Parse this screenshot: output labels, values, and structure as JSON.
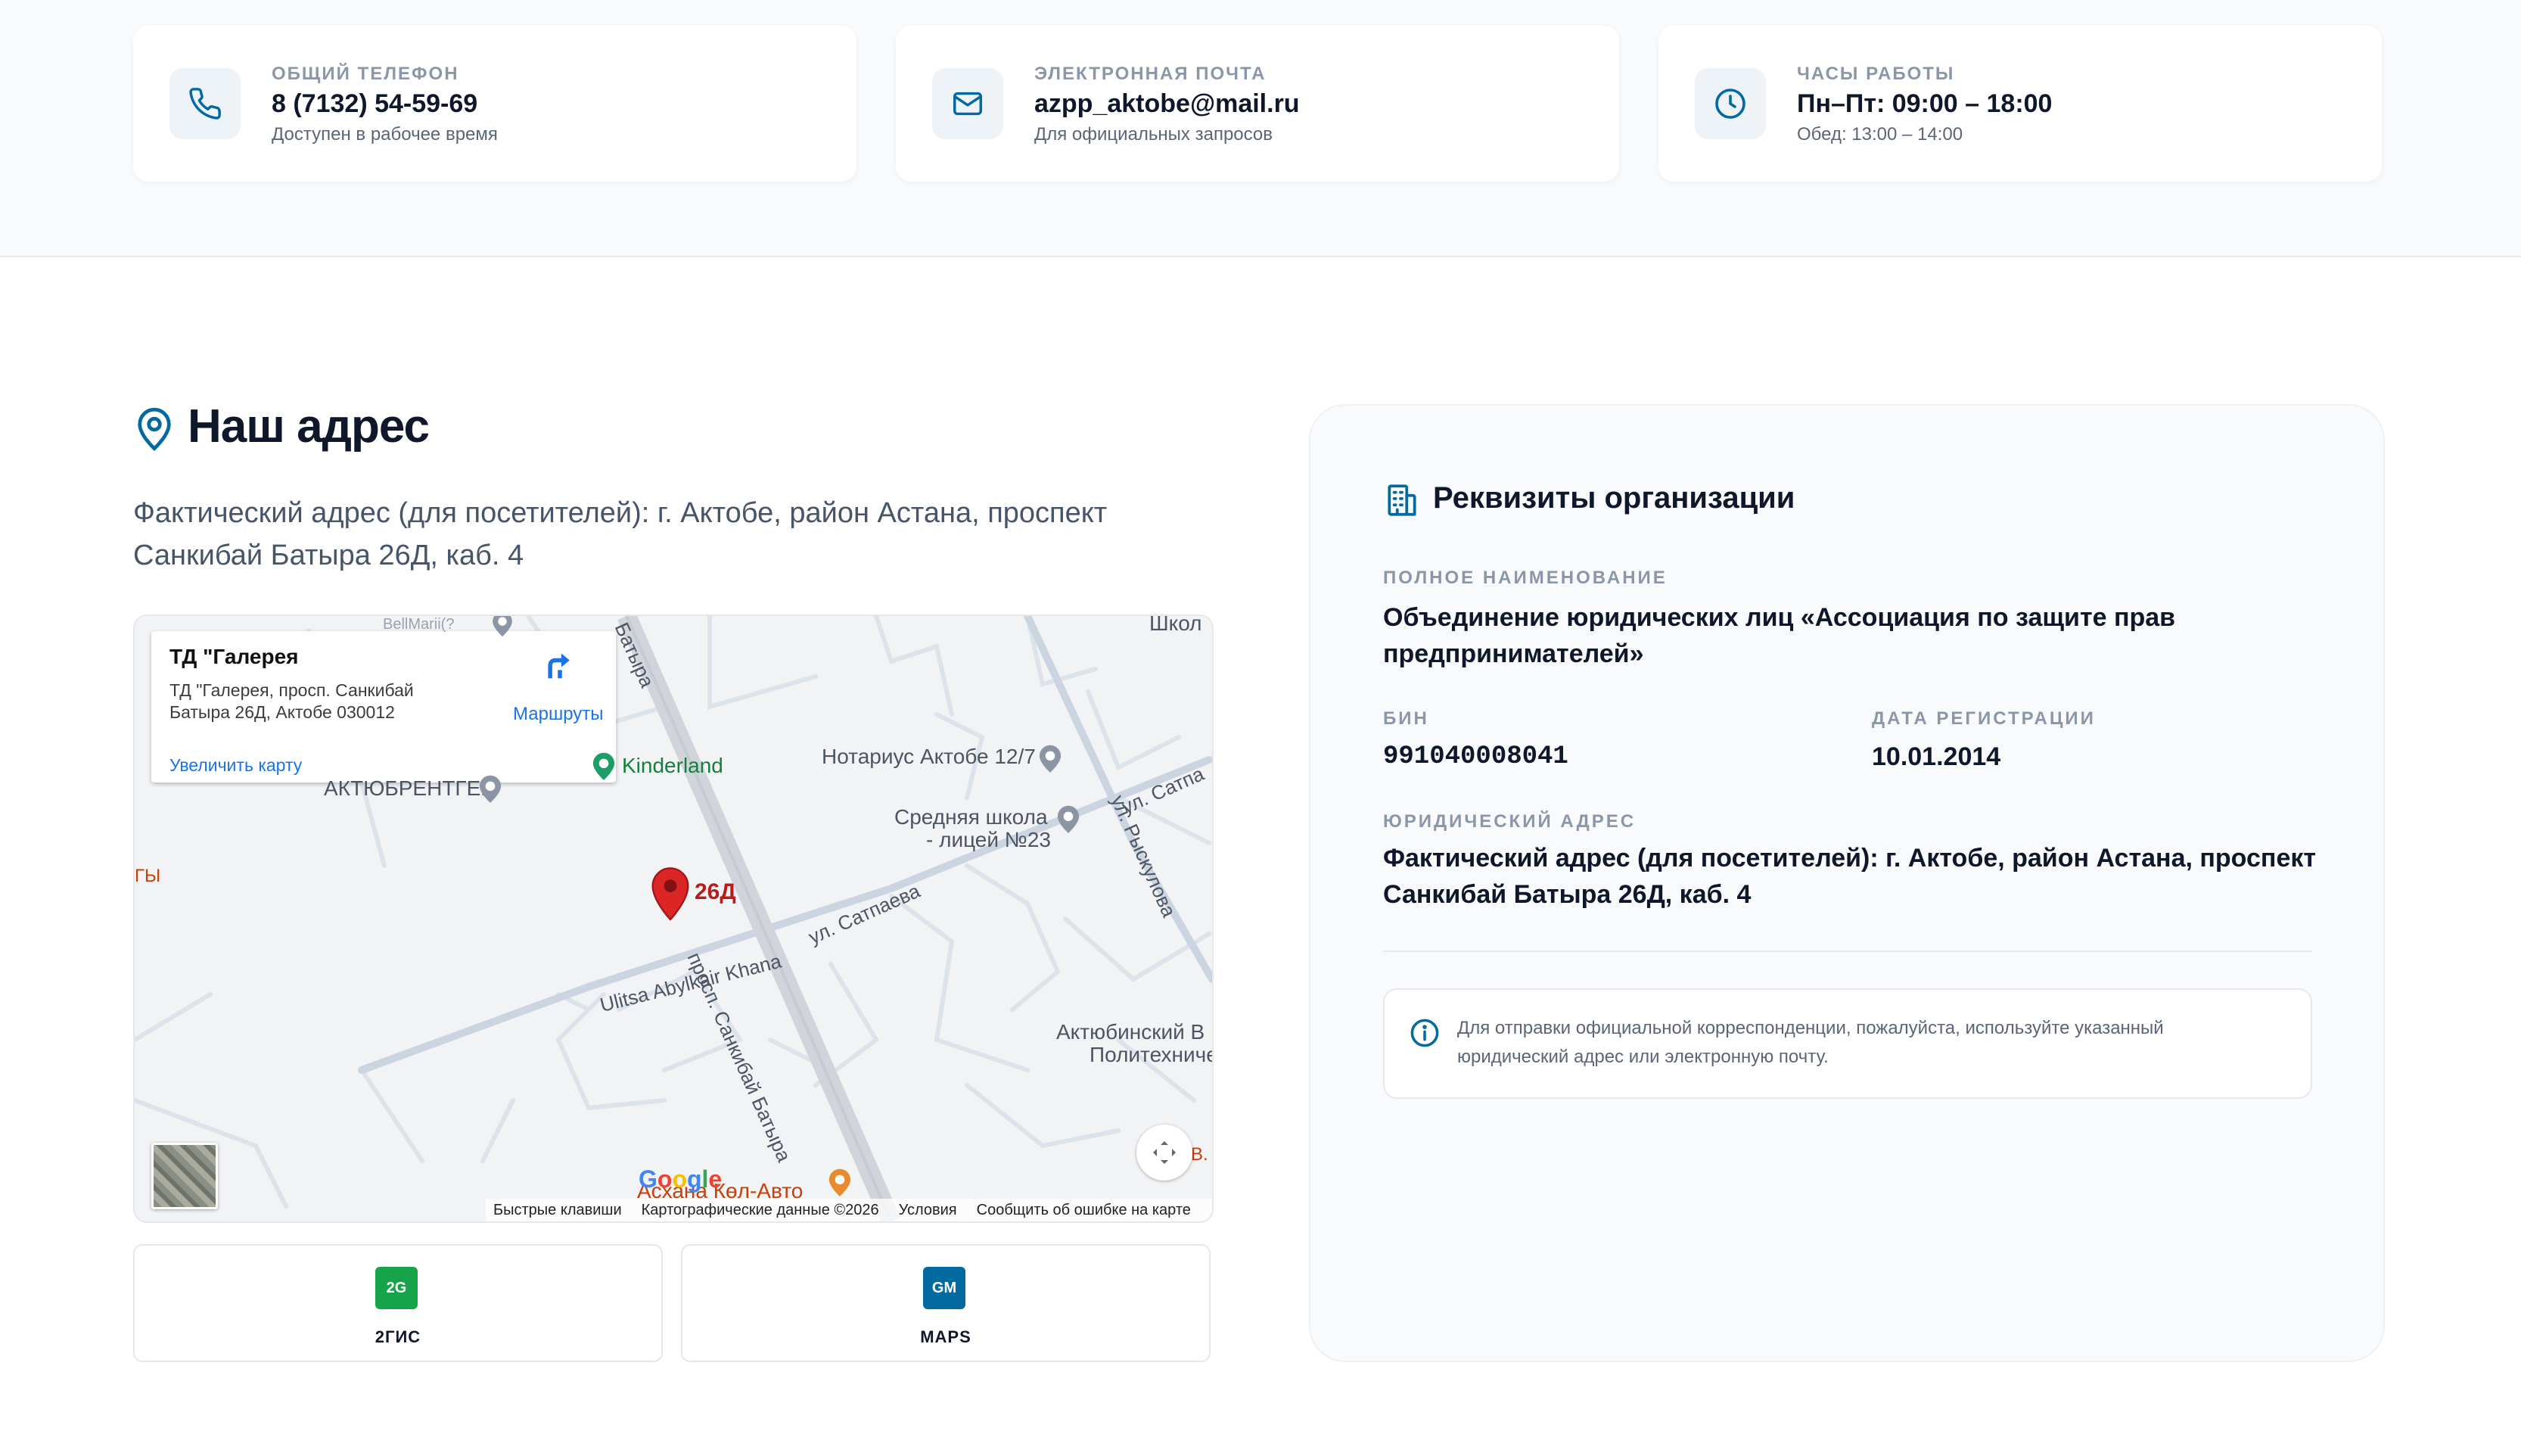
{
  "colors": {
    "accent": "#0369a1",
    "green_2gis": "#16a34a",
    "blue_gmaps": "#0369a1",
    "pin_red": "#dc2626"
  },
  "contacts": [
    {
      "icon": "phone-icon",
      "eyebrow": "ОБЩИЙ ТЕЛЕФОН",
      "value": "8 (7132) 54-59-69",
      "sub": "Доступен в рабочее время"
    },
    {
      "icon": "mail-icon",
      "eyebrow": "ЭЛЕКТРОННАЯ ПОЧТА",
      "value": "azpp_aktobe@mail.ru",
      "sub": "Для официальных запросов"
    },
    {
      "icon": "clock-icon",
      "eyebrow": "ЧАСЫ РАБОТЫ",
      "value": "Пн–Пт: 09:00 – 18:00",
      "sub": "Обед: 13:00 – 14:00"
    }
  ],
  "address": {
    "title": "Наш адрес",
    "text": "Фактический адрес (для посетителей): г. Актобе, район Астана, проспект Санкибай Батыра 26Д, каб. 4"
  },
  "map": {
    "place_title": "ТД \"Галерея",
    "place_address": "ТД \"Галерея, просп. Санкибай Батыра 26Д, Актобе 030012",
    "enlarge": "Увеличить карту",
    "routes": "Маршруты",
    "pin_label": "26Д",
    "google": "Google",
    "footer": {
      "shortcuts": "Быстрые клавиши",
      "map_data": "Картографические данные ©2026",
      "terms": "Условия",
      "report": "Сообщить об ошибке на карте"
    },
    "labels": {
      "kinderland": "Kinderland",
      "aktyubrentgen": "АКТЮБРЕНТГЕН",
      "notary": "Нотариус Актобе 12/7",
      "school_line1": "Средняя школа",
      "school_line2": "- лицей №23",
      "avenue": "просп. Санкибай Батыра",
      "avenue_top": "Батыра",
      "satpaeva": "ул. Сатпаева",
      "satpaeva_right": "ул. Сатпа",
      "ryskulova": "ул. Рыскулова",
      "abylkair": "Ulitsa Abylkair Khana",
      "aktobe_poly1": "Актюбинский В",
      "aktobe_poly2": "Политехничес",
      "askhana": "Асхана Көл-Авто",
      "shkol": "Школ",
      "left_partial": "ГЫ",
      "right_partial": "В.",
      "top_partial": "BellMarii(?"
    }
  },
  "map_buttons": [
    {
      "badge": "2G",
      "label": "2ГИС"
    },
    {
      "badge": "GM",
      "label": "MAPS"
    }
  ],
  "requisites": {
    "title": "Реквизиты организации",
    "full_name_label": "ПОЛНОЕ НАИМЕНОВАНИЕ",
    "full_name": "Объединение юридических лиц «Ассоциация по защите прав предпринимателей»",
    "bin_label": "БИН",
    "bin": "991040008041",
    "reg_label": "ДАТА РЕГИСТРАЦИИ",
    "reg_date": "10.01.2014",
    "legal_label": "ЮРИДИЧЕСКИЙ АДРЕС",
    "legal_address": "Фактический адрес (для посетителей): г. Актобе, район Астана, проспект Санкибай Батыра 26Д, каб. 4",
    "note": "Для отправки официальной корреспонденции, пожалуйста, используйте указанный юридический адрес или электронную почту."
  }
}
